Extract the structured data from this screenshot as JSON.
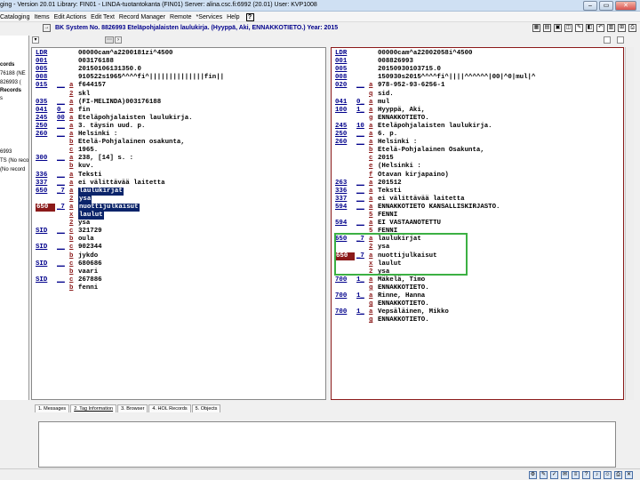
{
  "window": {
    "title": "ging - Version 20.01  Library: FIN01 - LINDA-tuotantokanta (FIN01)  Server: alina.csc.fi:6992 (20.01)  User: KVP1008",
    "minimize": "–",
    "restore": "▭",
    "close": "✕"
  },
  "menu": [
    "Cataloging",
    "Items",
    "Edit Actions",
    "Edit Text",
    "Record Manager",
    "Remote",
    "*Services",
    "Help"
  ],
  "menu_help_icon": "?",
  "record_title": "BK System No. 8826993 Eteläpohjalaisten laulukirja. (Hyyppä, Aki, ENNAKKOTIETO.) Year: 2015",
  "left_panel": [
    "cords",
    "76188 (NE",
    "826993 (",
    "Records",
    "s",
    "",
    "6993",
    "TS (No reco",
    "(No record"
  ],
  "left_record": [
    {
      "tag": "LDR",
      "ind": "",
      "code": "",
      "val": "00000cam^a2200181zi^4500"
    },
    {
      "tag": "001",
      "ind": "",
      "code": "",
      "val": "003176188"
    },
    {
      "tag": "005",
      "ind": "",
      "code": "",
      "val": "20150106131350.0"
    },
    {
      "tag": "008",
      "ind": "",
      "code": "",
      "val": "910522s1965^^^^fi^||||||||||||||fin||"
    },
    {
      "tag": "015",
      "ind": "__",
      "code": "a",
      "val": "f644157"
    },
    {
      "tag": "",
      "ind": "",
      "code": "2",
      "val": "skl"
    },
    {
      "tag": "035",
      "ind": "__",
      "code": "a",
      "val": "(FI-MELINDA)003176188"
    },
    {
      "tag": "041",
      "ind": "0_",
      "code": "a",
      "val": "fin"
    },
    {
      "tag": "245",
      "ind": "00",
      "code": "a",
      "val": "Eteläpohjalaisten laulukirja."
    },
    {
      "tag": "250",
      "ind": "__",
      "code": "a",
      "val": "3. täysin uud. p."
    },
    {
      "tag": "260",
      "ind": "__",
      "code": "a",
      "val": "Helsinki :"
    },
    {
      "tag": "",
      "ind": "",
      "code": "b",
      "val": "Etelä-Pohjalainen osakunta,"
    },
    {
      "tag": "",
      "ind": "",
      "code": "c",
      "val": "1965."
    },
    {
      "tag": "300",
      "ind": "__",
      "code": "a",
      "val": "238, [14] s. :"
    },
    {
      "tag": "",
      "ind": "",
      "code": "b",
      "val": "kuv."
    },
    {
      "tag": "336",
      "ind": "__",
      "code": "a",
      "val": "Teksti"
    },
    {
      "tag": "337",
      "ind": "__",
      "code": "a",
      "val": "ei välittävää laitetta"
    },
    {
      "tag": "650",
      "ind": "_7",
      "code": "a",
      "val": "laulukirjat",
      "sel": true
    },
    {
      "tag": "",
      "ind": "",
      "code": "2",
      "val": "ysa",
      "sel": true
    },
    {
      "tag": "650",
      "ind": "_7",
      "code": "a",
      "val": "nuottijulkaisut",
      "sel": true,
      "hl": true
    },
    {
      "tag": "",
      "ind": "",
      "code": "x",
      "val": "laulut",
      "sel": true
    },
    {
      "tag": "",
      "ind": "",
      "code": "2",
      "val": "ysa"
    },
    {
      "tag": "SID",
      "ind": "__",
      "code": "c",
      "val": "321729"
    },
    {
      "tag": "",
      "ind": "",
      "code": "b",
      "val": "oula"
    },
    {
      "tag": "SID",
      "ind": "__",
      "code": "c",
      "val": "902344"
    },
    {
      "tag": "",
      "ind": "",
      "code": "b",
      "val": "jykdo"
    },
    {
      "tag": "SID",
      "ind": "__",
      "code": "c",
      "val": "680686"
    },
    {
      "tag": "",
      "ind": "",
      "code": "b",
      "val": "vaari"
    },
    {
      "tag": "SID",
      "ind": "__",
      "code": "c",
      "val": "267886"
    },
    {
      "tag": "",
      "ind": "",
      "code": "b",
      "val": "fenni"
    }
  ],
  "right_record": [
    {
      "tag": "LDR",
      "ind": "",
      "code": "",
      "val": "00000cam^a22002058i^4500"
    },
    {
      "tag": "001",
      "ind": "",
      "code": "",
      "val": "008826993"
    },
    {
      "tag": "005",
      "ind": "",
      "code": "",
      "val": "20150930103715.0"
    },
    {
      "tag": "008",
      "ind": "",
      "code": "",
      "val": "150930s2015^^^^fi^||||^^^^^^|00|^0|mul|^"
    },
    {
      "tag": "020",
      "ind": "__",
      "code": "a",
      "val": "978-952-93-6256-1"
    },
    {
      "tag": "",
      "ind": "",
      "code": "q",
      "val": "sid."
    },
    {
      "tag": "041",
      "ind": "0_",
      "code": "a",
      "val": "mul"
    },
    {
      "tag": "100",
      "ind": "1_",
      "code": "a",
      "val": "Hyyppä, Aki,"
    },
    {
      "tag": "",
      "ind": "",
      "code": "g",
      "val": "ENNAKKOTIETO."
    },
    {
      "tag": "245",
      "ind": "10",
      "code": "a",
      "val": "Eteläpohjalaisten laulukirja."
    },
    {
      "tag": "250",
      "ind": "__",
      "code": "a",
      "val": "6. p."
    },
    {
      "tag": "260",
      "ind": "__",
      "code": "a",
      "val": "Helsinki :"
    },
    {
      "tag": "",
      "ind": "",
      "code": "b",
      "val": "Etelä-Pohjalainen Osakunta,"
    },
    {
      "tag": "",
      "ind": "",
      "code": "c",
      "val": "2015"
    },
    {
      "tag": "",
      "ind": "",
      "code": "e",
      "val": "(Helsinki :"
    },
    {
      "tag": "",
      "ind": "",
      "code": "f",
      "val": "Otavan kirjapaino)"
    },
    {
      "tag": "263",
      "ind": "__",
      "code": "a",
      "val": "201512"
    },
    {
      "tag": "336",
      "ind": "__",
      "code": "a",
      "val": "Teksti"
    },
    {
      "tag": "337",
      "ind": "__",
      "code": "a",
      "val": "ei välittävää laitetta"
    },
    {
      "tag": "594",
      "ind": "__",
      "code": "a",
      "val": "ENNAKKOTIETO KANSALLISKIRJASTO."
    },
    {
      "tag": "",
      "ind": "",
      "code": "5",
      "val": "FENNI"
    },
    {
      "tag": "594",
      "ind": "__",
      "code": "a",
      "val": "EI VASTAANOTETTU"
    },
    {
      "tag": "",
      "ind": "",
      "code": "5",
      "val": "FENNI"
    },
    {
      "tag": "650",
      "ind": "_7",
      "code": "a",
      "val": "laulukirjat"
    },
    {
      "tag": "",
      "ind": "",
      "code": "2",
      "val": "ysa"
    },
    {
      "tag": "650",
      "ind": "_7",
      "code": "a",
      "val": "nuottijulkaisut",
      "hl": true
    },
    {
      "tag": "",
      "ind": "",
      "code": "x",
      "val": "laulut"
    },
    {
      "tag": "",
      "ind": "",
      "code": "2",
      "val": "ysa"
    },
    {
      "tag": "700",
      "ind": "1_",
      "code": "a",
      "val": "Mäkelä, Timo"
    },
    {
      "tag": "",
      "ind": "",
      "code": "g",
      "val": "ENNAKKOTIETO."
    },
    {
      "tag": "700",
      "ind": "1_",
      "code": "a",
      "val": "Rinne, Hanna"
    },
    {
      "tag": "",
      "ind": "",
      "code": "g",
      "val": "ENNAKKOTIETO."
    },
    {
      "tag": "700",
      "ind": "1_",
      "code": "a",
      "val": "Vepsäläinen, Mikko"
    },
    {
      "tag": "",
      "ind": "",
      "code": "g",
      "val": "ENNAKKOTIETO."
    }
  ],
  "bottom_tabs": [
    "1. Messages",
    "2. Tag Information",
    "3. Browser",
    "4. HOL Records",
    "5. Objects"
  ],
  "colors": {
    "tag": "#00008b",
    "code": "#8b1a1a",
    "selection": "#0a246a",
    "highlight_tag": "#8b1a1a",
    "compare_box": "#3cb043"
  }
}
